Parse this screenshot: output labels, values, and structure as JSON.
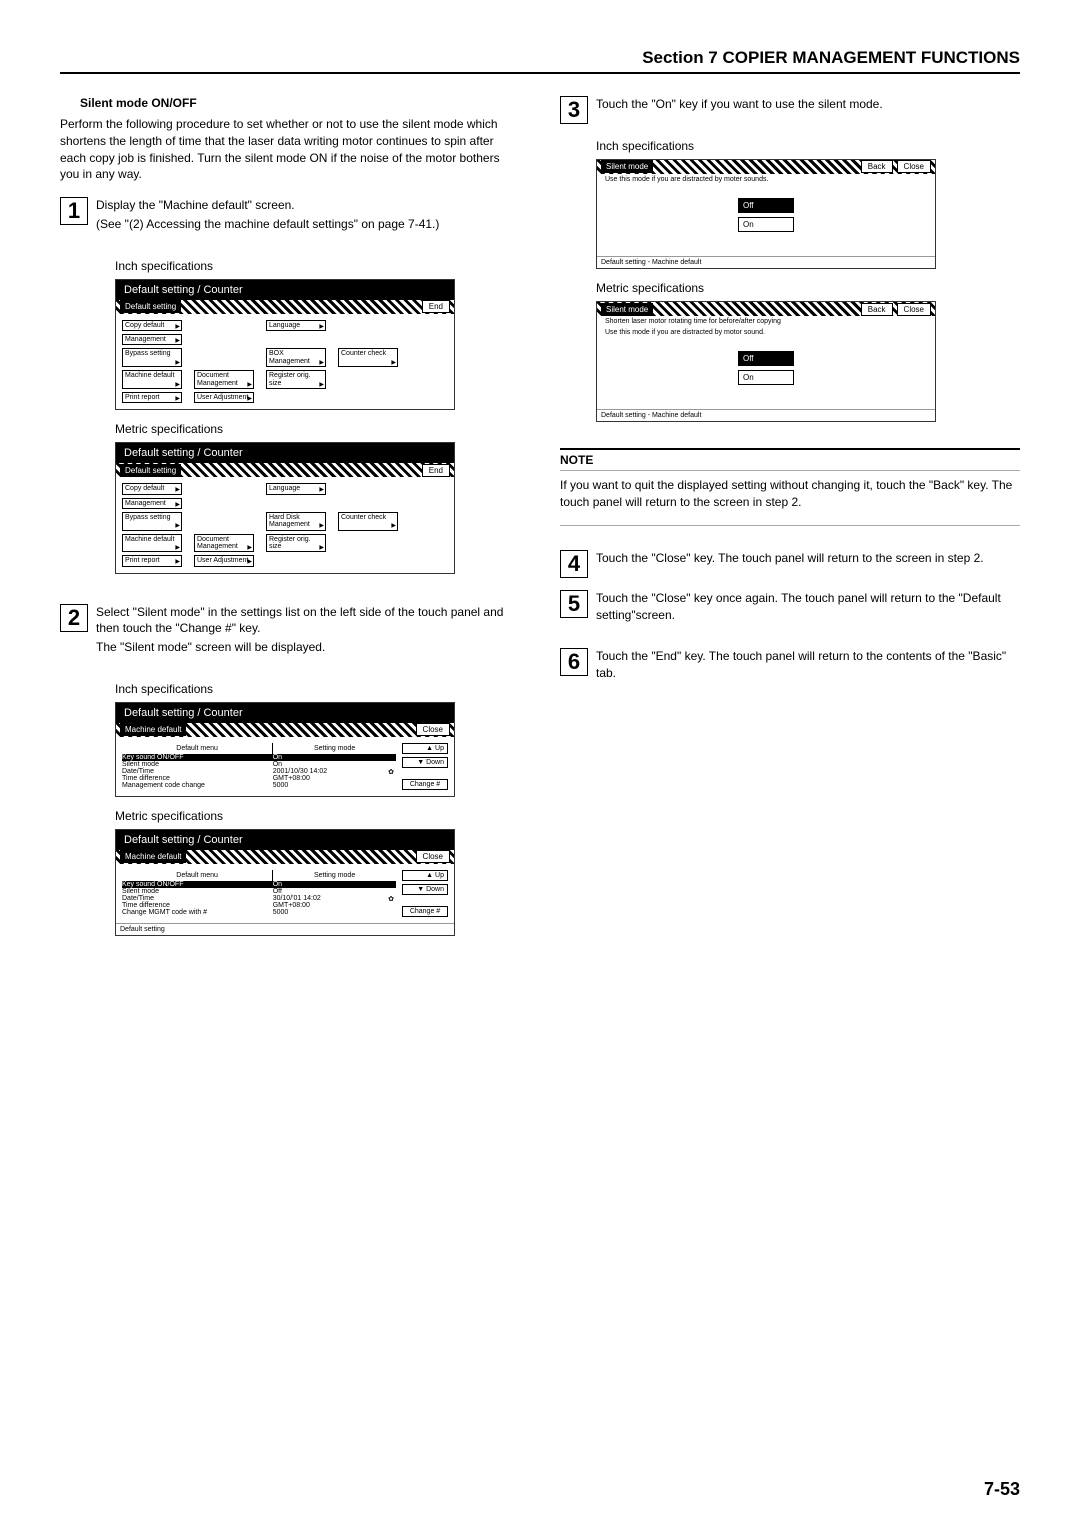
{
  "header": "Section 7  COPIER MANAGEMENT FUNCTIONS",
  "left": {
    "title": "Silent mode ON/OFF",
    "intro": "Perform the following procedure to set whether or not to use the silent mode which shortens the length of time that the laser data writing motor continues to spin after each copy job is finished. Turn the silent mode ON if the noise of the motor bothers you in any way.",
    "step1a": "Display the \"Machine default\" screen.",
    "step1b": "(See \"(2) Accessing the machine default settings\" on page 7-41.)",
    "inch_label": "Inch specifications",
    "metric_label": "Metric specifications",
    "panel_title": "Default setting / Counter",
    "chip_default": "Default setting",
    "chip_machine": "Machine default",
    "btn_end": "End",
    "btn_close": "Close",
    "btn_back": "Back",
    "btn_up": "Up",
    "btn_down": "Down",
    "btn_change": "Change #",
    "hdr_menu": "Default menu",
    "hdr_mode": "Setting mode",
    "tabs_inch": {
      "r1": [
        "Copy default",
        "",
        "Language",
        "",
        "Management",
        ""
      ],
      "r2": [
        "",
        "",
        "Bypass setting",
        "",
        "BOX Management",
        "Counter check"
      ],
      "r3": [
        "Machine default",
        "Document Management",
        "Register orig. size",
        "",
        "Print report",
        "User Adjustment"
      ]
    },
    "tabs_metric": {
      "r1": [
        "Copy default",
        "",
        "Language",
        "",
        "Management",
        ""
      ],
      "r2": [
        "",
        "",
        "Bypass setting",
        "",
        "Hard Disk Management",
        "Counter check"
      ],
      "r3": [
        "Machine default",
        "Document Management",
        "Register orig. size",
        "",
        "Print report",
        "User Adjustment"
      ]
    },
    "md_inch": [
      [
        "Key sound ON/OFF",
        "On"
      ],
      [
        "Silent mode",
        "On"
      ],
      [
        "Date/Time",
        "2001/10/30 14:02"
      ],
      [
        "Time difference",
        "GMT+08:00"
      ],
      [
        "Management code change",
        "5000"
      ]
    ],
    "md_metric": [
      [
        "Key sound ON/OFF",
        "On"
      ],
      [
        "Silent mode",
        "Off"
      ],
      [
        "Date/Time",
        "30/10/'01 14:02"
      ],
      [
        "Time difference",
        "GMT+08:00"
      ],
      [
        "Change MGMT code with #",
        "5000"
      ]
    ],
    "step2a": "Select \"Silent mode\" in the settings list on the left side of the touch panel and then touch the \"Change #\" key.",
    "step2b": "The \"Silent mode\" screen will be displayed."
  },
  "right": {
    "step3": "Touch the \"On\" key if you want to use the silent mode.",
    "silent_chip": "Silent mode",
    "silent_msg_inch": "Use this mode if you are distracted by moter sounds.",
    "silent_msg_metric1": "Shorten laser motor rotating time for before/after copying",
    "silent_msg_metric2": "Use this mode if you are distracted by motor sound.",
    "off": "Off",
    "on": "On",
    "footer": "Default setting - Machine default",
    "note_label": "NOTE",
    "note_text": "If you want to quit the displayed setting without changing it, touch the \"Back\" key. The touch panel will return to the screen in step 2.",
    "step4": "Touch the \"Close\" key. The touch panel will return to the screen in step 2.",
    "step5": "Touch the \"Close\" key once again. The touch panel will return to the \"Default setting\"screen.",
    "step6": "Touch the \"End\" key. The touch panel will return to the contents of the \"Basic\" tab."
  },
  "page_number": "7-53",
  "nums": {
    "n1": "1",
    "n2": "2",
    "n3": "3",
    "n4": "4",
    "n5": "5",
    "n6": "6"
  }
}
